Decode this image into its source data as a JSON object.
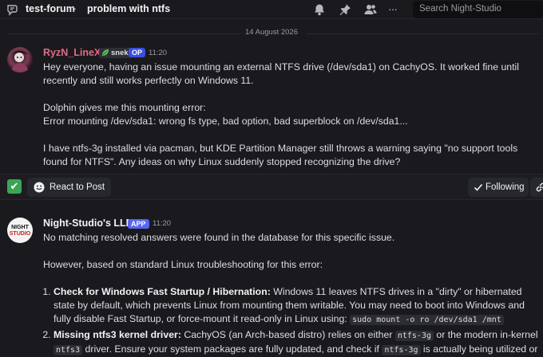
{
  "topbar": {
    "channel": "test-forum",
    "chevron": "›",
    "thread": "problem with ntfs",
    "icons": [
      "thread-icon",
      "bell-icon",
      "pin-icon",
      "members-icon",
      "more-icon"
    ],
    "more_glyph": "···",
    "search_placeholder": "Search Night-Studio"
  },
  "date_divider": "14 August 2026",
  "messages": [
    {
      "author": "RyzN_LineX",
      "badge": "snek",
      "tag": "OP",
      "time": "11:20",
      "lines": [
        "Hey everyone, having an issue mounting an external NTFS drive (/dev/sda1) on CachyOS. It worked fine until recently and still works perfectly on Windows 11.",
        "Dolphin gives me this mounting error:",
        "Error mounting /dev/sda1: wrong fs type, bad option, bad superblock on /dev/sda1...",
        "I have ntfs-3g installed via pacman, but KDE Partition Manager still throws a warning saying \"no support tools found for NTFS\". Any ideas on why Linux suddenly stopped recognizing the drive?"
      ]
    },
    {
      "author": "Night-Studio's LLM",
      "tag": "APP",
      "time": "11:20",
      "avatar_text_1": "NIGHT",
      "avatar_text_2": "STUDIO",
      "intro": "No matching resolved answers were found in the database for this specific issue.",
      "intro2": "However, based on standard Linux troubleshooting for this error:",
      "items": [
        {
          "title": "Check for Windows Fast Startup / Hibernation:",
          "text": " Windows 11 leaves NTFS drives in a \"dirty\" or hibernated state by default, which prevents Linux from mounting them writable. You may need to boot into Windows and fully disable Fast Startup, or force-mount it read-only in Linux using: ",
          "code": "sudo mount -o ro /dev/sda1 /mnt"
        },
        {
          "title": "Missing ntfs3 kernel driver:",
          "text_a": " CachyOS (an Arch-based distro) relies on either ",
          "code_a": "ntfs-3g",
          "text_b": " or the modern in-kernel ",
          "code_b": "ntfs3",
          "text_c": " driver. Ensure your system packages are fully updated, and check if ",
          "code_c": "ntfs-3g",
          "text_d": " is actually being utilized or if"
        }
      ]
    }
  ],
  "actions": {
    "check_glyph": "✔",
    "react_label": "React to Post",
    "following_label": "Following"
  },
  "colors": {
    "background": "#1a1a1e",
    "op_author": "#e16a85",
    "op_tag": "#3b4ee0",
    "app_tag": "#5865f2",
    "check_green": "#3aa655"
  }
}
